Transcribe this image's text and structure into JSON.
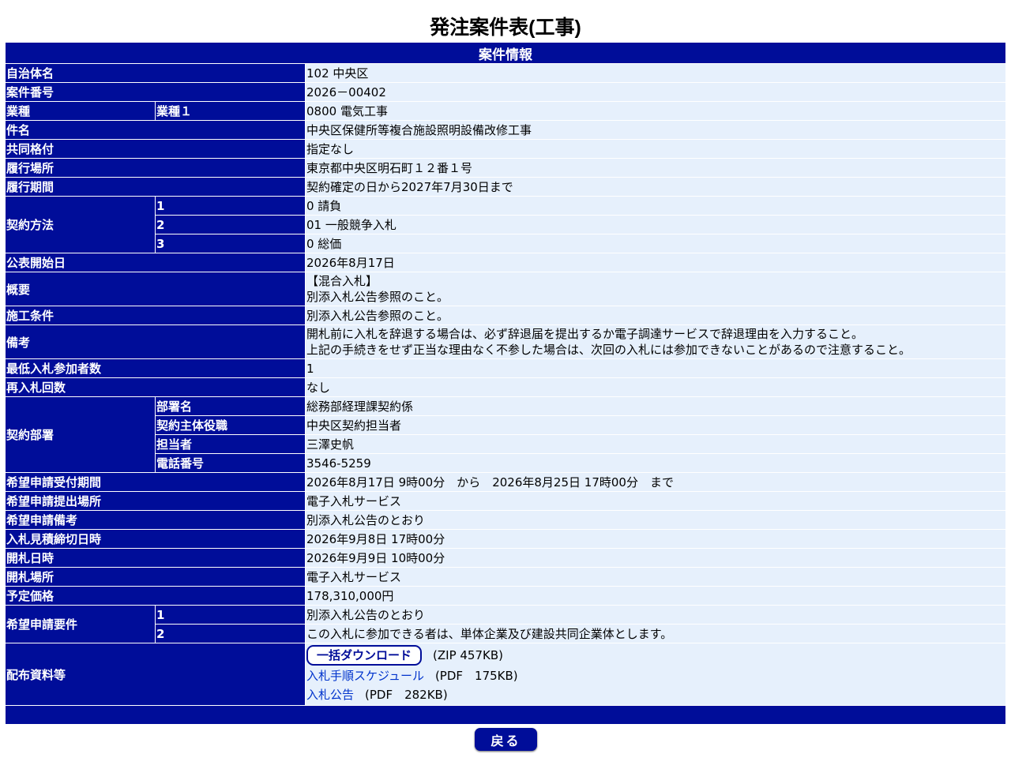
{
  "page_title": "発注案件表(工事)",
  "section_header": "案件情報",
  "fields": {
    "municipality": {
      "label": "自治体名",
      "value": "102 中央区"
    },
    "case_number": {
      "label": "案件番号",
      "value": "2026－00402"
    },
    "industry": {
      "label": "業種",
      "sublabel": "業種１",
      "value": "0800 電気工事"
    },
    "title": {
      "label": "件名",
      "value": "中央区保健所等複合施設照明設備改修工事"
    },
    "joint_rating": {
      "label": "共同格付",
      "value": "指定なし"
    },
    "location": {
      "label": "履行場所",
      "value": "東京都中央区明石町１２番１号"
    },
    "period": {
      "label": "履行期間",
      "value": "契約確定の日から2027年7月30日まで"
    },
    "contract_method": {
      "label": "契約方法",
      "items": [
        {
          "sublabel": "1",
          "value": "0 請負"
        },
        {
          "sublabel": "2",
          "value": "01 一般競争入札"
        },
        {
          "sublabel": "3",
          "value": "0 総価"
        }
      ]
    },
    "publish_date": {
      "label": "公表開始日",
      "value": "2026年8月17日"
    },
    "summary": {
      "label": "概要",
      "lines": [
        "【混合入札】",
        "別添入札公告参照のこと。"
      ]
    },
    "conditions": {
      "label": "施工条件",
      "value": "別添入札公告参照のこと。"
    },
    "remarks": {
      "label": "備考",
      "lines": [
        "開札前に入札を辞退する場合は、必ず辞退届を提出するか電子調達サービスで辞退理由を入力すること。",
        "上記の手続きをせず正当な理由なく不参した場合は、次回の入札には参加できないことがあるので注意すること。"
      ]
    },
    "min_bidders": {
      "label": "最低入札参加者数",
      "value": "1"
    },
    "rebid_count": {
      "label": "再入札回数",
      "value": "なし"
    },
    "department": {
      "label": "契約部署",
      "items": [
        {
          "sublabel": "部署名",
          "value": "総務部経理課契約係"
        },
        {
          "sublabel": "契約主体役職",
          "value": "中央区契約担当者"
        },
        {
          "sublabel": "担当者",
          "value": "三澤史帆"
        },
        {
          "sublabel": "電話番号",
          "value": "3546-5259"
        }
      ]
    },
    "application_period": {
      "label": "希望申請受付期間",
      "value": "2026年8月17日 9時00分　から　2026年8月25日 17時00分　まで"
    },
    "application_place": {
      "label": "希望申請提出場所",
      "value": "電子入札サービス"
    },
    "application_remarks": {
      "label": "希望申請備考",
      "value": "別添入札公告のとおり"
    },
    "estimate_deadline": {
      "label": "入札見積締切日時",
      "value": "2026年9月8日 17時00分"
    },
    "opening_datetime": {
      "label": "開札日時",
      "value": "2026年9月9日 10時00分"
    },
    "opening_place": {
      "label": "開札場所",
      "value": "電子入札サービス"
    },
    "planned_price": {
      "label": "予定価格",
      "value": "178,310,000円"
    },
    "requirements": {
      "label": "希望申請要件",
      "items": [
        {
          "sublabel": "1",
          "value": "別添入札公告のとおり"
        },
        {
          "sublabel": "2",
          "value": "この入札に参加できる者は、単体企業及び建設共同企業体とします。"
        }
      ]
    },
    "distribution": {
      "label": "配布資料等",
      "bulk_download": {
        "label": "一括ダウンロード",
        "meta": "(ZIP 457KB)"
      },
      "files": [
        {
          "name": "入札手順スケジュール",
          "meta": "(PDF　175KB)"
        },
        {
          "name": "入札公告",
          "meta": "(PDF　282KB)"
        }
      ]
    }
  },
  "back_button": "戻る"
}
